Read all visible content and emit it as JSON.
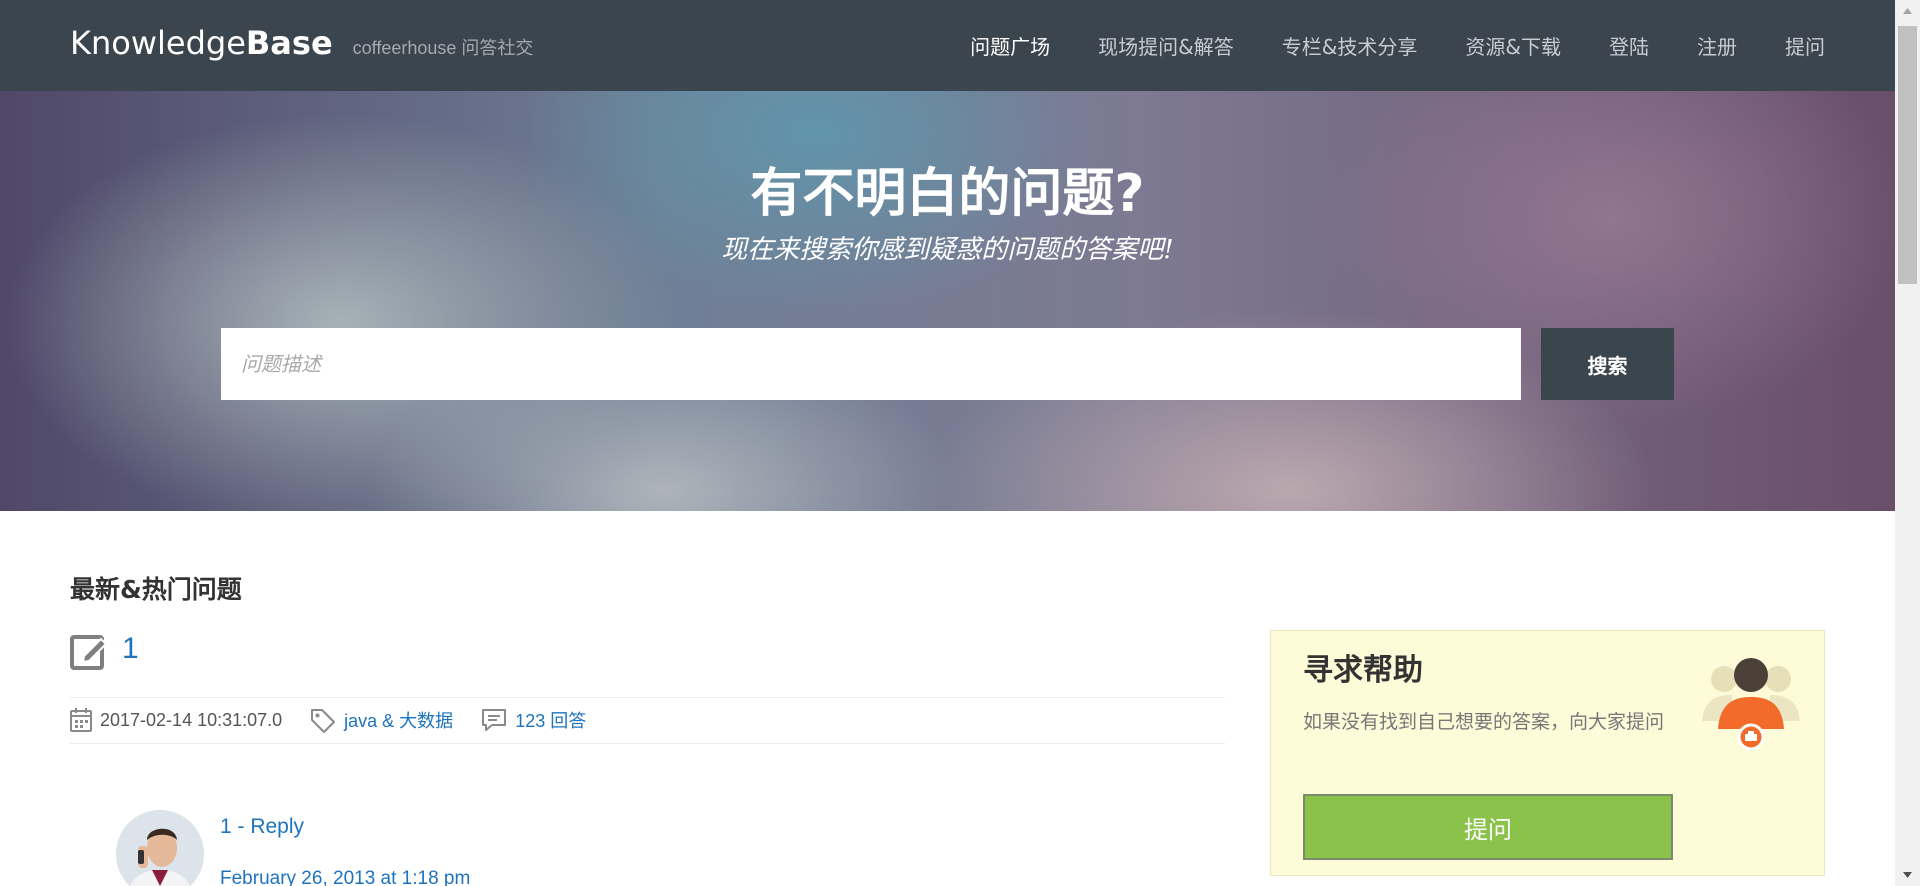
{
  "header": {
    "brand_light": "Knowledge",
    "brand_bold": "Base",
    "tagline": "coffeerhouse 问答社交",
    "nav": [
      {
        "label": "问题广场",
        "active": true
      },
      {
        "label": "现场提问&解答",
        "active": false
      },
      {
        "label": "专栏&技术分享",
        "active": false
      },
      {
        "label": "资源&下载",
        "active": false
      },
      {
        "label": "登陆",
        "active": false
      },
      {
        "label": "注册",
        "active": false
      },
      {
        "label": "提问",
        "active": false
      }
    ]
  },
  "hero": {
    "title": "有不明白的问题?",
    "subtitle": "现在来搜索你感到疑惑的问题的答案吧!",
    "search_placeholder": "问题描述",
    "search_value": "",
    "search_button": "搜索"
  },
  "main": {
    "section_title": "最新&热门问题",
    "question": {
      "title": "1",
      "icon": "edit-icon",
      "date": "2017-02-14 10:31:07.0",
      "tags": "java & 大数据",
      "answers": "123 回答"
    },
    "reply": {
      "name": "1 - Reply",
      "date": "February 26, 2013 at 1:18 pm"
    }
  },
  "sidebar": {
    "help_title": "寻求帮助",
    "help_desc": "如果没有找到自己想要的答案，向大家提问",
    "help_button": "提问"
  },
  "colors": {
    "header_bg": "#3b454d",
    "link": "#1e73be",
    "help_bg": "#fefbd9",
    "help_button": "#8bc34a"
  }
}
